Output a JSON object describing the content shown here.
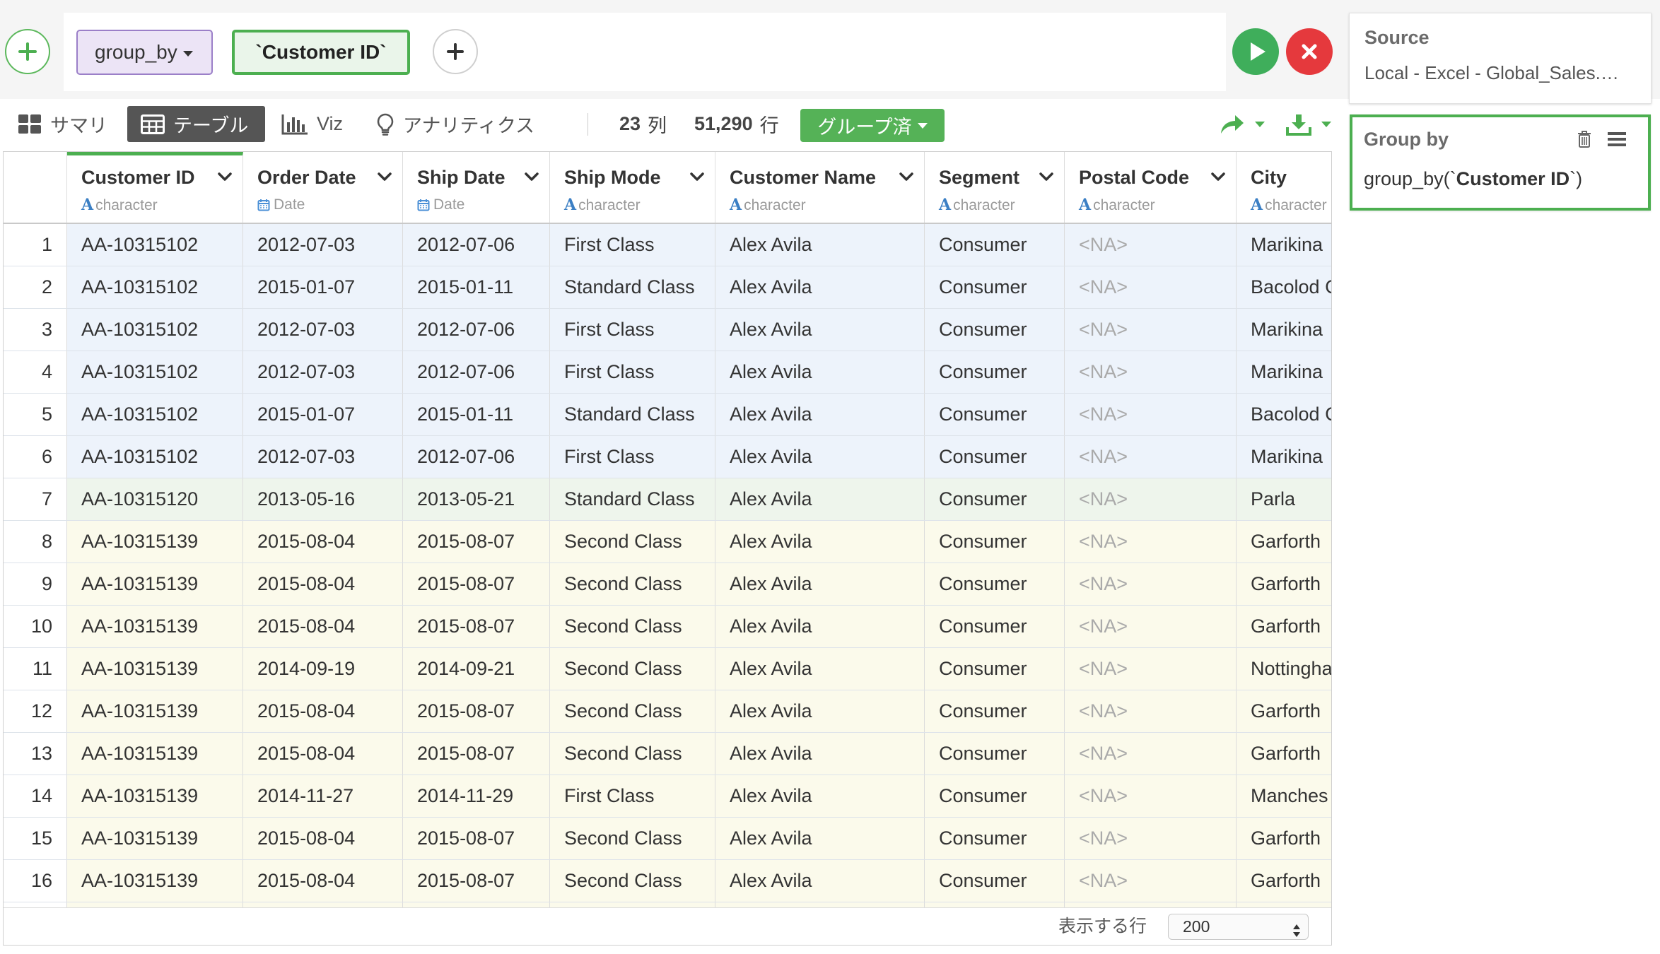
{
  "command_bar": {
    "add_step_icon": "plus-icon",
    "function_label": "group_by",
    "argument_label": "`Customer ID`",
    "add_argument_icon": "plus-icon",
    "run_icon": "play-icon",
    "cancel_icon": "close-icon"
  },
  "view_tabs": [
    {
      "label": "サマリ",
      "icon": "grid-icon"
    },
    {
      "label": "テーブル",
      "icon": "table-icon",
      "active": true
    },
    {
      "label": "Viz",
      "icon": "bar-chart-icon"
    },
    {
      "label": "アナリティクス",
      "icon": "lightbulb-icon"
    }
  ],
  "stats": {
    "column_count": "23",
    "column_unit": "列",
    "row_count": "51,290",
    "row_unit": "行"
  },
  "group_status_button": "グループ済",
  "toolbar_actions": {
    "share_icon": "share-arrow-icon",
    "download_icon": "download-icon"
  },
  "table": {
    "columns": [
      {
        "name": "Customer ID",
        "type": "character",
        "type_icon": "character-type-icon",
        "grouped": true
      },
      {
        "name": "Order Date",
        "type": "Date",
        "type_icon": "calendar-icon"
      },
      {
        "name": "Ship Date",
        "type": "Date",
        "type_icon": "calendar-icon"
      },
      {
        "name": "Ship Mode",
        "type": "character",
        "type_icon": "character-type-icon"
      },
      {
        "name": "Customer Name",
        "type": "character",
        "type_icon": "character-type-icon"
      },
      {
        "name": "Segment",
        "type": "character",
        "type_icon": "character-type-icon"
      },
      {
        "name": "Postal Code",
        "type": "character",
        "type_icon": "character-type-icon"
      },
      {
        "name": "City",
        "type": "character",
        "type_icon": "character-type-icon"
      }
    ],
    "rows": [
      {
        "num": "1",
        "cells": [
          "AA-10315102",
          "2012-07-03",
          "2012-07-06",
          "First Class",
          "Alex Avila",
          "Consumer",
          "<NA>",
          "Marikina"
        ]
      },
      {
        "num": "2",
        "cells": [
          "AA-10315102",
          "2015-01-07",
          "2015-01-11",
          "Standard Class",
          "Alex Avila",
          "Consumer",
          "<NA>",
          "Bacolod C"
        ]
      },
      {
        "num": "3",
        "cells": [
          "AA-10315102",
          "2012-07-03",
          "2012-07-06",
          "First Class",
          "Alex Avila",
          "Consumer",
          "<NA>",
          "Marikina"
        ]
      },
      {
        "num": "4",
        "cells": [
          "AA-10315102",
          "2012-07-03",
          "2012-07-06",
          "First Class",
          "Alex Avila",
          "Consumer",
          "<NA>",
          "Marikina"
        ]
      },
      {
        "num": "5",
        "cells": [
          "AA-10315102",
          "2015-01-07",
          "2015-01-11",
          "Standard Class",
          "Alex Avila",
          "Consumer",
          "<NA>",
          "Bacolod C"
        ]
      },
      {
        "num": "6",
        "cells": [
          "AA-10315102",
          "2012-07-03",
          "2012-07-06",
          "First Class",
          "Alex Avila",
          "Consumer",
          "<NA>",
          "Marikina"
        ]
      },
      {
        "num": "7",
        "cells": [
          "AA-10315120",
          "2013-05-16",
          "2013-05-21",
          "Standard Class",
          "Alex Avila",
          "Consumer",
          "<NA>",
          "Parla"
        ]
      },
      {
        "num": "8",
        "cells": [
          "AA-10315139",
          "2015-08-04",
          "2015-08-07",
          "Second Class",
          "Alex Avila",
          "Consumer",
          "<NA>",
          "Garforth"
        ]
      },
      {
        "num": "9",
        "cells": [
          "AA-10315139",
          "2015-08-04",
          "2015-08-07",
          "Second Class",
          "Alex Avila",
          "Consumer",
          "<NA>",
          "Garforth"
        ]
      },
      {
        "num": "10",
        "cells": [
          "AA-10315139",
          "2015-08-04",
          "2015-08-07",
          "Second Class",
          "Alex Avila",
          "Consumer",
          "<NA>",
          "Garforth"
        ]
      },
      {
        "num": "11",
        "cells": [
          "AA-10315139",
          "2014-09-19",
          "2014-09-21",
          "Second Class",
          "Alex Avila",
          "Consumer",
          "<NA>",
          "Nottingha"
        ]
      },
      {
        "num": "12",
        "cells": [
          "AA-10315139",
          "2015-08-04",
          "2015-08-07",
          "Second Class",
          "Alex Avila",
          "Consumer",
          "<NA>",
          "Garforth"
        ]
      },
      {
        "num": "13",
        "cells": [
          "AA-10315139",
          "2015-08-04",
          "2015-08-07",
          "Second Class",
          "Alex Avila",
          "Consumer",
          "<NA>",
          "Garforth"
        ]
      },
      {
        "num": "14",
        "cells": [
          "AA-10315139",
          "2014-11-27",
          "2014-11-29",
          "First Class",
          "Alex Avila",
          "Consumer",
          "<NA>",
          "Manches"
        ]
      },
      {
        "num": "15",
        "cells": [
          "AA-10315139",
          "2015-08-04",
          "2015-08-07",
          "Second Class",
          "Alex Avila",
          "Consumer",
          "<NA>",
          "Garforth"
        ]
      },
      {
        "num": "16",
        "cells": [
          "AA-10315139",
          "2015-08-04",
          "2015-08-07",
          "Second Class",
          "Alex Avila",
          "Consumer",
          "<NA>",
          "Garforth"
        ]
      }
    ]
  },
  "footer": {
    "rows_label": "表示する行",
    "rows_per_page": "200"
  },
  "right_panel": {
    "source": {
      "title": "Source",
      "value": "Local - Excel - Global_Sales.…"
    },
    "steps": [
      {
        "title": "Group by",
        "code_prefix": "group_by(`",
        "code_arg": "Customer ID",
        "code_suffix": "`)",
        "icons": [
          "trash-icon",
          "menu-icon"
        ]
      }
    ]
  },
  "colors": {
    "accent_green": "#4caf50",
    "run_green": "#3fae5b",
    "cancel_red": "#e5393d",
    "function_token_bg": "#ece4f6",
    "type_icon_blue": "#3b7fc4",
    "row_group_backgrounds": [
      "#edf3fb",
      "#eef5ec",
      "#fbfaeb"
    ]
  }
}
